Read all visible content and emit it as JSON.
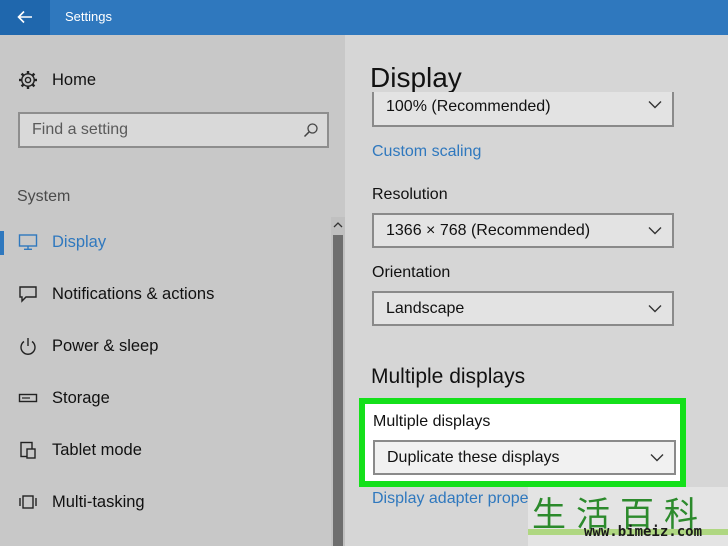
{
  "window": {
    "title": "Settings"
  },
  "sidebar": {
    "home_label": "Home",
    "search_placeholder": "Find a setting",
    "section_label": "System",
    "items": [
      {
        "label": "Display",
        "icon": "monitor-icon",
        "active": true
      },
      {
        "label": "Notifications & actions",
        "icon": "notifications-icon"
      },
      {
        "label": "Power & sleep",
        "icon": "power-icon"
      },
      {
        "label": "Storage",
        "icon": "storage-icon"
      },
      {
        "label": "Tablet mode",
        "icon": "tablet-mode-icon"
      },
      {
        "label": "Multi-tasking",
        "icon": "multitasking-icon"
      }
    ]
  },
  "main": {
    "title": "Display",
    "scale_value": "100% (Recommended)",
    "custom_scaling_link": "Custom scaling",
    "resolution_label": "Resolution",
    "resolution_value": "1366 × 768 (Recommended)",
    "orientation_label": "Orientation",
    "orientation_value": "Landscape",
    "multiple_displays_heading": "Multiple displays",
    "multiple_displays_label": "Multiple displays",
    "multiple_displays_value": "Duplicate these displays",
    "adapter_link": "Display adapter prope"
  },
  "watermark": {
    "characters": "生活百科",
    "url": "www.bimeiz.com"
  },
  "colors": {
    "accent": "#2f78be",
    "highlight": "#14e01a"
  }
}
